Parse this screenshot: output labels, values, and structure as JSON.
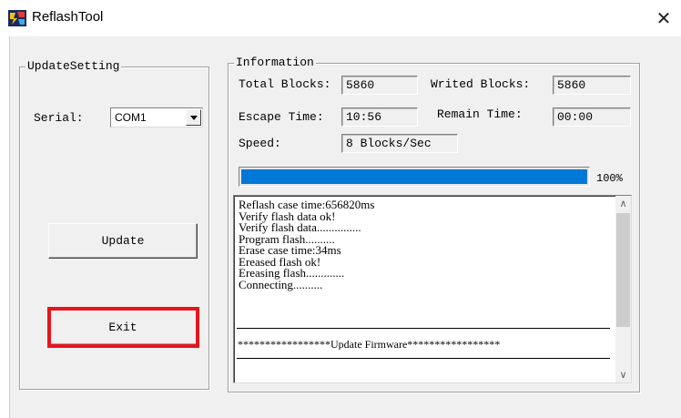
{
  "window": {
    "title": "ReflashTool",
    "close_glyph": "✕",
    "icon": "app-icon"
  },
  "update_setting": {
    "caption": "UpdateSetting",
    "serial_label": "Serial:",
    "serial_value": "COM1",
    "update_button": "Update",
    "exit_button": "Exit"
  },
  "information": {
    "caption": "Information",
    "total_blocks_label": "Total Blocks:",
    "total_blocks_value": "5860",
    "writed_blocks_label": "Writed Blocks:",
    "writed_blocks_value": "5860",
    "escape_time_label": "Escape Time:",
    "escape_time_value": "10:56",
    "remain_time_label": "Remain Time:",
    "remain_time_value": "00:00",
    "speed_label": "Speed:",
    "speed_value": "8 Blocks/Sec",
    "progress_percent": 100,
    "progress_text": "100%"
  },
  "log": {
    "lines": [
      "Reflash  case time:656820ms",
      "Verify flash data ok!",
      "Verify flash data...............",
      "Program flash..........",
      "Erase case time:34ms",
      "Ereased flash ok!",
      "Ereasing flash.............",
      "Connecting.........."
    ],
    "banner": "*****************Update Firmware*****************"
  },
  "colors": {
    "progress": "#0078d7",
    "highlight": "#e8141c",
    "panel_bg": "#f0f0f0"
  }
}
